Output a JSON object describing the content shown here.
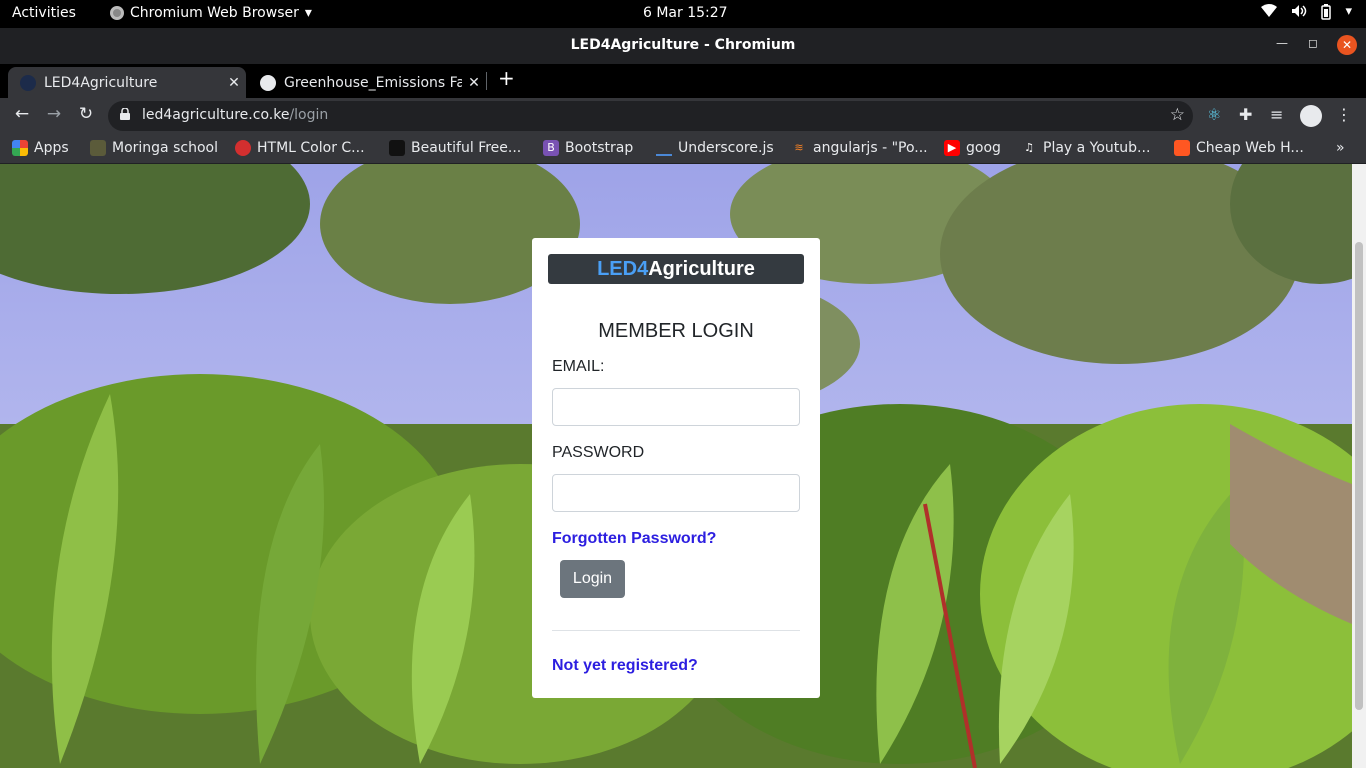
{
  "system": {
    "activities": "Activities",
    "app_menu": "Chromium Web Browser",
    "clock": "6 Mar  15:27"
  },
  "window": {
    "title": "LED4Agriculture - Chromium"
  },
  "tabs": [
    {
      "label": "LED4Agriculture",
      "active": true
    },
    {
      "label": "Greenhouse_Emissions Fa",
      "active": false
    }
  ],
  "address_bar": {
    "host": "led4agriculture.co.ke",
    "path": "/login"
  },
  "bookmarks": [
    {
      "label": "Apps",
      "icon": "apps-grid-icon"
    },
    {
      "label": "Moringa school",
      "icon": "moringa-icon"
    },
    {
      "label": "HTML Color C...",
      "icon": "html-color-icon"
    },
    {
      "label": "Beautiful Free...",
      "icon": "beautiful-free-icon"
    },
    {
      "label": "Bootstrap",
      "icon": "bootstrap-icon"
    },
    {
      "label": "Underscore.js",
      "icon": "underscore-icon"
    },
    {
      "label": "angularjs - \"Po...",
      "icon": "stackoverflow-icon"
    },
    {
      "label": "goog",
      "icon": "youtube-icon"
    },
    {
      "label": "Play a Youtub...",
      "icon": "music-note-icon"
    },
    {
      "label": "Cheap Web H...",
      "icon": "hosting-icon"
    }
  ],
  "login": {
    "brand_part1": "LED4",
    "brand_part2": "Agriculture",
    "title": "MEMBER LOGIN",
    "email_label": "EMAIL:",
    "email_value": "",
    "password_label": "PASSWORD",
    "password_value": "",
    "forgot_link": "Forgotten Password?",
    "login_button": "Login",
    "register_link": "Not yet registered?"
  },
  "colors": {
    "brand_accent": "#4a9ff5",
    "link": "#2c1ee0",
    "button": "#6c757d",
    "brand_bar": "#343a40"
  }
}
